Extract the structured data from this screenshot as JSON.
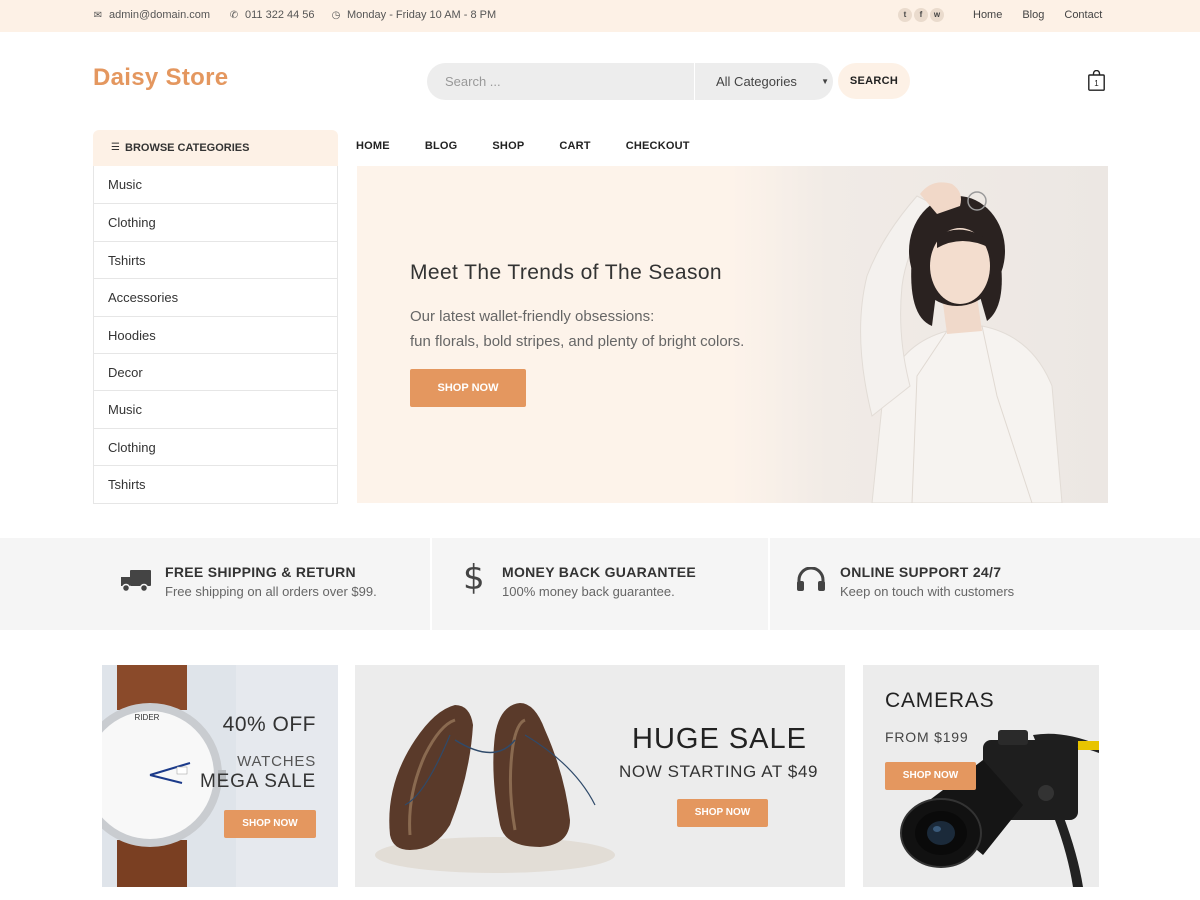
{
  "topbar": {
    "email": "admin@domain.com",
    "phone": "011 322 44 56",
    "hours": "Monday - Friday 10 AM - 8 PM",
    "links": [
      "Home",
      "Blog",
      "Contact"
    ]
  },
  "header": {
    "logo": "Daisy Store",
    "search_placeholder": "Search ...",
    "category_selected": "All Categories",
    "search_label": "SEARCH",
    "cart_count": "1"
  },
  "sidebar": {
    "title": "BROWSE CATEGORIES",
    "items": [
      "Music",
      "Clothing",
      "Tshirts",
      "Accessories",
      "Hoodies",
      "Decor",
      "Music",
      "Clothing",
      "Tshirts"
    ]
  },
  "nav": {
    "items": [
      "HOME",
      "BLOG",
      "SHOP",
      "CART",
      "CHECKOUT"
    ]
  },
  "hero": {
    "title": "Meet The Trends of The Season",
    "line1": "Our latest wallet-friendly obsessions:",
    "line2": "fun florals, bold stripes, and plenty of bright colors.",
    "button": "SHOP NOW"
  },
  "features": [
    {
      "icon": "truck-icon",
      "title": "FREE SHIPPING & RETURN",
      "subtitle": "Free shipping on all orders over $99."
    },
    {
      "icon": "dollar-icon",
      "title": "MONEY BACK GUARANTEE",
      "subtitle": "100% money back guarantee."
    },
    {
      "icon": "headphones-icon",
      "title": "ONLINE SUPPORT 24/7",
      "subtitle": "Keep on touch with customers"
    }
  ],
  "banners": {
    "watch": {
      "line1": "40% OFF",
      "line2": "WATCHES",
      "line3": "MEGA SALE",
      "button": "SHOP NOW"
    },
    "shoes": {
      "line1": "HUGE SALE",
      "line2": "NOW STARTING AT $49",
      "button": "SHOP NOW"
    },
    "camera": {
      "line1": "CAMERAS",
      "line2": "FROM $199",
      "button": "SHOP NOW"
    }
  },
  "colors": {
    "accent": "#e4975f",
    "topbar_bg": "#fdf1e6",
    "feature_bg": "#f5f5f5"
  }
}
